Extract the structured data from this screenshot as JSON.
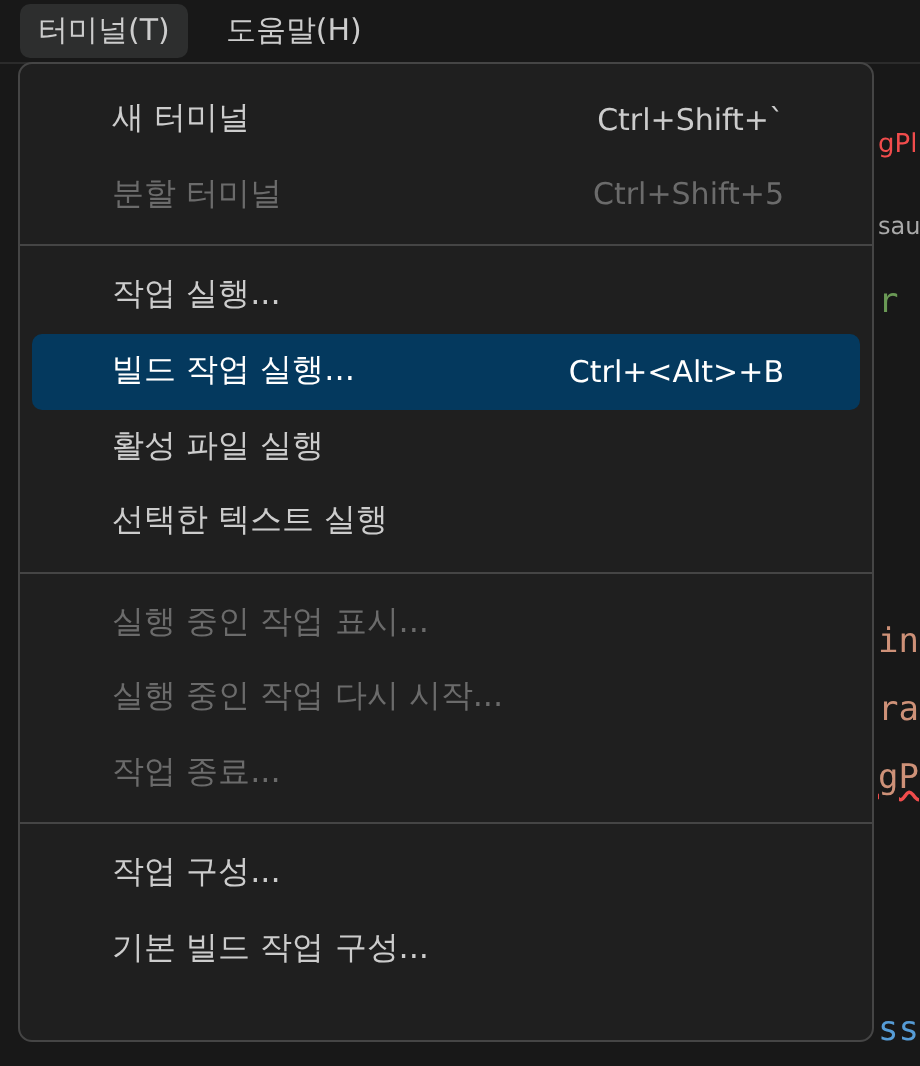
{
  "menubar": [
    {
      "label": "터미널(T)",
      "selected": true
    },
    {
      "label": "도움말(H)",
      "selected": false
    }
  ],
  "menu": {
    "groups": [
      [
        {
          "label": "새 터미널",
          "shortcut": "Ctrl+Shift+`",
          "disabled": false,
          "selected": false
        },
        {
          "label": "분할 터미널",
          "shortcut": "Ctrl+Shift+5",
          "disabled": true,
          "selected": false
        }
      ],
      [
        {
          "label": "작업 실행...",
          "disabled": false,
          "selected": false
        },
        {
          "label": "빌드 작업 실행...",
          "shortcut": "Ctrl+<Alt>+B",
          "disabled": false,
          "selected": true
        },
        {
          "label": "활성 파일 실행",
          "disabled": false,
          "selected": false
        },
        {
          "label": "선택한 텍스트 실행",
          "disabled": false,
          "selected": false
        }
      ],
      [
        {
          "label": "실행 중인 작업 표시...",
          "disabled": true,
          "selected": false
        },
        {
          "label": "실행 중인 작업 다시 시작...",
          "disabled": true,
          "selected": false
        },
        {
          "label": "작업 종료...",
          "disabled": true,
          "selected": false
        }
      ],
      [
        {
          "label": "작업 구성...",
          "disabled": false,
          "selected": false
        },
        {
          "label": "기본 빌드 작업 구성...",
          "disabled": false,
          "selected": false
        }
      ]
    ]
  },
  "editor": [
    {
      "text": "gPl",
      "kind": "tab"
    },
    {
      "text": "sau",
      "kind": "breadcrumb"
    },
    {
      "text": "r",
      "kind": "green"
    },
    {
      "text": "in",
      "kind": "orange"
    },
    {
      "text": "ra",
      "kind": "orange"
    },
    {
      "text": "gP",
      "kind": "error"
    },
    {
      "text": "ss",
      "kind": "blue"
    }
  ]
}
